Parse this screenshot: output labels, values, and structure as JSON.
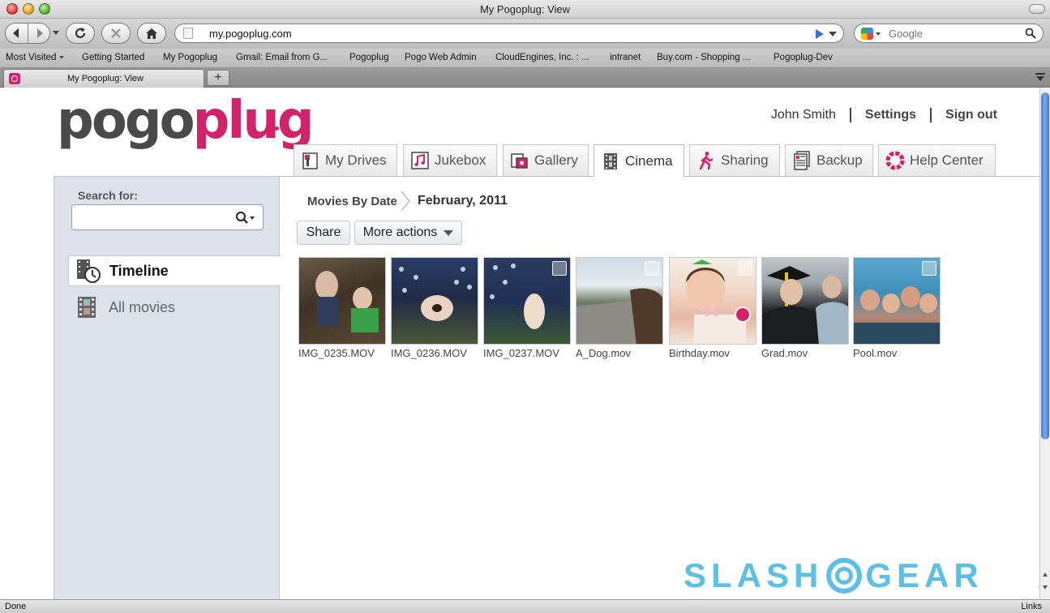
{
  "window": {
    "title": "My Pogoplug: View"
  },
  "toolbar": {
    "url": "my.pogoplug.com",
    "search_placeholder": "Google"
  },
  "bookmarks": [
    "Most Visited",
    "Getting Started",
    "My Pogoplug",
    "Gmail: Email from G...",
    "Pogoplug",
    "Pogo Web Admin",
    "CloudEngines, Inc. : ...",
    "intranet",
    "Buy.com - Shopping ...",
    "Pogoplug-Dev"
  ],
  "browser_tab": {
    "title": "My Pogoplug: View",
    "new_tab": "+"
  },
  "logo": {
    "part1": "pogo",
    "part2": "plug"
  },
  "user": {
    "name": "John Smith",
    "settings": "Settings",
    "signout": "Sign out"
  },
  "tabs": [
    {
      "label": "My Drives",
      "icon": "drive-icon"
    },
    {
      "label": "Jukebox",
      "icon": "music-icon"
    },
    {
      "label": "Gallery",
      "icon": "photo-icon"
    },
    {
      "label": "Cinema",
      "icon": "film-icon"
    },
    {
      "label": "Sharing",
      "icon": "walking-person-icon"
    },
    {
      "label": "Backup",
      "icon": "backup-icon"
    },
    {
      "label": "Help Center",
      "icon": "lifebuoy-icon"
    }
  ],
  "active_tab": "Cinema",
  "sidebar": {
    "search_label": "Search for:",
    "search_value": "",
    "items": [
      {
        "label": "Timeline",
        "icon": "film-clock-icon",
        "active": true
      },
      {
        "label": "All movies",
        "icon": "film-strip-icon",
        "active": false
      }
    ]
  },
  "breadcrumb": {
    "parent": "Movies By Date",
    "current": "February, 2011"
  },
  "actions": {
    "share": "Share",
    "more": "More actions"
  },
  "movies": [
    {
      "name": "IMG_0235.MOV"
    },
    {
      "name": "IMG_0236.MOV"
    },
    {
      "name": "IMG_0237.MOV"
    },
    {
      "name": "A_Dog.mov"
    },
    {
      "name": "Birthday.mov",
      "shared": true
    },
    {
      "name": "Grad.mov"
    },
    {
      "name": "Pool.mov"
    }
  ],
  "watermark": {
    "left": "SLASH",
    "right": "GEAR"
  },
  "status": {
    "left": "Done",
    "right": "Links"
  },
  "colors": {
    "brand": "#d1226a",
    "sidebar_bg": "#dde1ea",
    "watermark": "#40b5e2"
  }
}
